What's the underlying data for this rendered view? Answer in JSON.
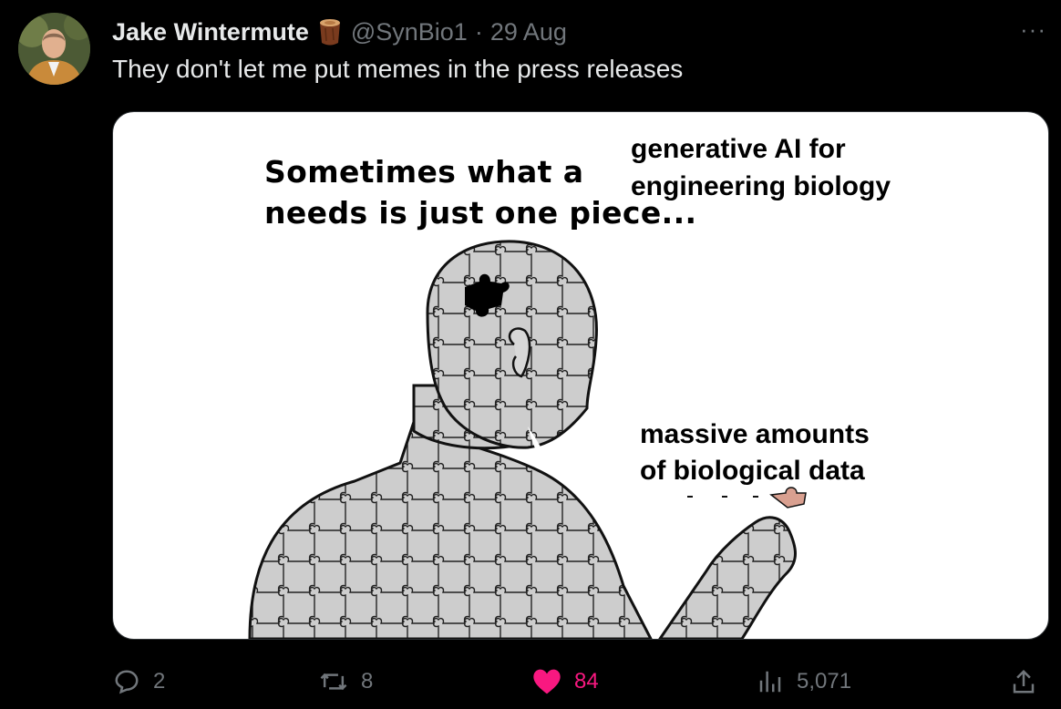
{
  "tweet": {
    "author_name": "Jake Wintermute",
    "author_emoji": "wood-log-icon",
    "handle": "@SynBio1",
    "separator": "·",
    "date": "29 Aug",
    "more_label": "···",
    "text": "They don't let me put memes in the press releases"
  },
  "meme": {
    "caption_line1": "Sometimes what a",
    "caption_line2": "needs is just one piece...",
    "label_top_line1": "generative AI for",
    "label_top_line2": "engineering biology",
    "label_bottom_line1": "massive amounts",
    "label_bottom_line2": "of biological data"
  },
  "actions": {
    "replies": "2",
    "reposts": "8",
    "likes": "84",
    "views": "5,071"
  },
  "colors": {
    "background": "#000000",
    "text": "#e7e9ea",
    "muted": "#71767b",
    "like": "#f91880"
  }
}
